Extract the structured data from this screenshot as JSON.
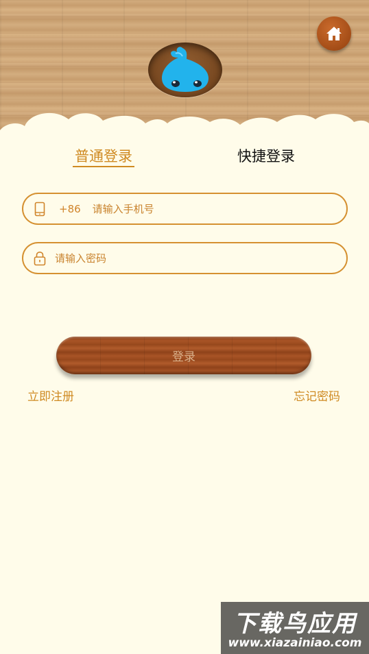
{
  "header": {
    "logo": "blue-water-drop-mascot",
    "home_icon": "home-icon"
  },
  "tabs": {
    "normal_login": "普通登录",
    "quick_login": "快捷登录",
    "active": "normal_login"
  },
  "phone_field": {
    "prefix": "+86",
    "placeholder": "请输入手机号",
    "value": "",
    "icon": "phone-icon"
  },
  "password_field": {
    "placeholder": "请输入密码",
    "value": "",
    "icon": "lock-icon"
  },
  "login_button": {
    "label": "登录"
  },
  "links": {
    "register": "立即注册",
    "forgot": "忘记密码"
  },
  "watermark": {
    "title": "下载鸟应用",
    "url": "www.xiazainiao.com"
  },
  "colors": {
    "accent": "#cf8a22",
    "background": "#fffcea",
    "wood": "#a85426"
  }
}
